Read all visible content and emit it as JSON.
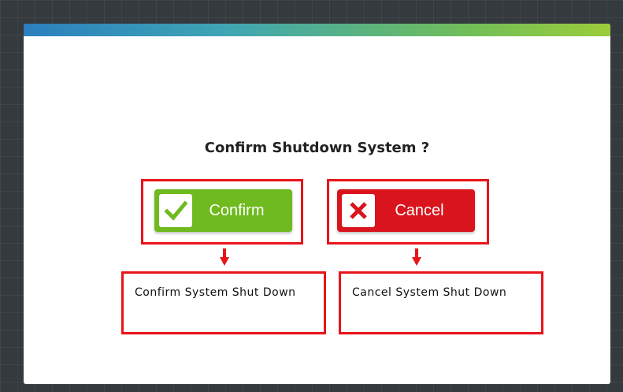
{
  "dialog": {
    "title": "Confirm Shutdown System ?",
    "confirm_button": {
      "label": "Confirm",
      "icon": "check-icon",
      "color": "#6fba1e"
    },
    "cancel_button": {
      "label": "Cancel",
      "icon": "close-icon",
      "color": "#d9141d"
    }
  },
  "annotations": {
    "confirm_note": "Confirm System Shut Down",
    "cancel_note": "Cancel System Shut Down",
    "highlight_color": "#e8141a"
  }
}
